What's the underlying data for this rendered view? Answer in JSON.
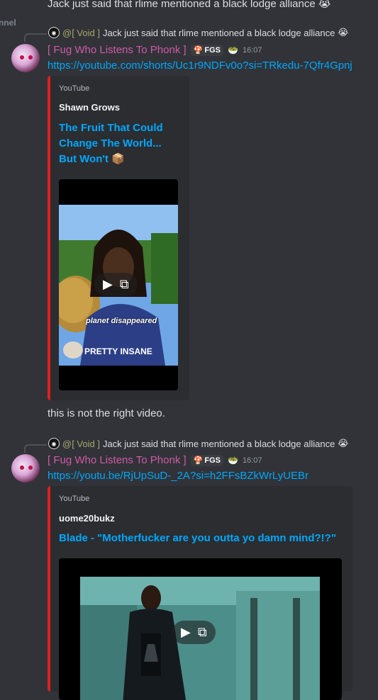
{
  "top_message": {
    "text": "Jack just said that rlime mentioned a black lodge alliance",
    "emoji": "😭"
  },
  "channel_fragment": "nnel",
  "messages": [
    {
      "reply": {
        "name": "@[ Void ]",
        "text": "Jack just said that rlime mentioned a black lodge alliance",
        "emoji": "😭"
      },
      "author": "[ Fug Who Listens To Phonk ]",
      "tag": "FGS",
      "time": "16:07",
      "link": "https://youtube.com/shorts/Uc1r9NDFv0o?si=TRkedu-7Qfr4Gpnj",
      "embed": {
        "provider": "YouTube",
        "author": "Shawn Grows",
        "title_lines": [
          "The Fruit That Could",
          "Change The World...",
          "But Won't 📦"
        ],
        "caption": "planet disappeared",
        "shirt_text": "PRETTY INSANE"
      },
      "followup": "this is not the right video."
    },
    {
      "reply": {
        "name": "@[ Void ]",
        "text": "Jack just said that rlime mentioned a black lodge alliance",
        "emoji": "😭"
      },
      "author": "[ Fug Who Listens To Phonk ]",
      "tag": "FGS",
      "time": "16:07",
      "link": "https://youtu.be/RjUpSuD-_2A?si=h2FFsBZkWrLyUEBr",
      "embed": {
        "provider": "YouTube",
        "author": "uome20bukz",
        "title": "Blade - \"Motherfucker are you outta yo damn mind?!?\""
      }
    }
  ],
  "icons": {
    "play": "play-icon",
    "popout": "popout-icon",
    "mushroom": "mushroom-icon",
    "bowl": "bowl-icon"
  }
}
